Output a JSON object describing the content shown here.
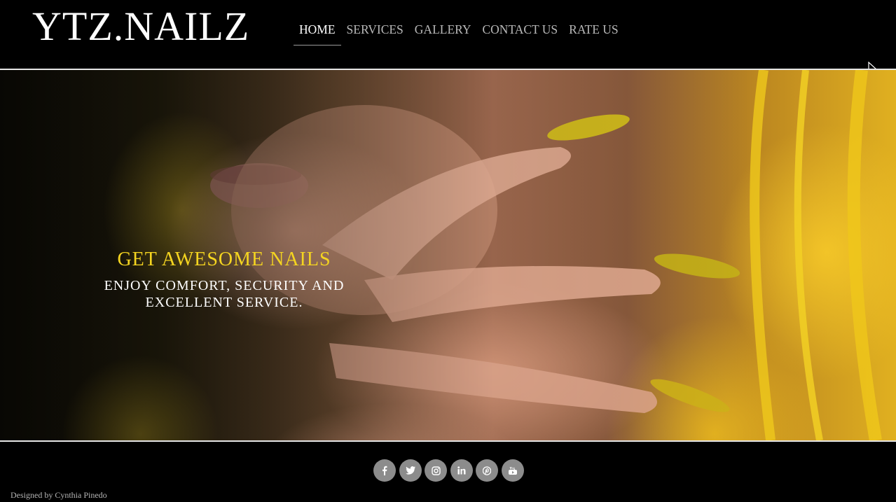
{
  "header": {
    "logo": "YTZ.NAILZ",
    "nav": [
      {
        "label": "HOME",
        "active": true
      },
      {
        "label": "SERVICES",
        "active": false
      },
      {
        "label": "GALLERY",
        "active": false
      },
      {
        "label": "CONTACT US",
        "active": false
      },
      {
        "label": "RATE US",
        "active": false
      }
    ]
  },
  "hero": {
    "title": "GET AWESOME NAILS",
    "subtitle": "ENJOY COMFORT, SECURITY AND EXCELLENT SERVICE.",
    "image": "close-up of hand with long nude and yellow-tipped nails against yellow hair"
  },
  "footer": {
    "socials": [
      "facebook-icon",
      "twitter-icon",
      "instagram-icon",
      "linkedin-icon",
      "pinterest-icon",
      "youtube-icon"
    ],
    "credit": "Designed by Cynthia Pinedo"
  },
  "colors": {
    "background": "#000000",
    "hero_title": "#f4d420",
    "social_bg": "#8c8c8c",
    "nav_inactive": "#b9b9b9"
  }
}
